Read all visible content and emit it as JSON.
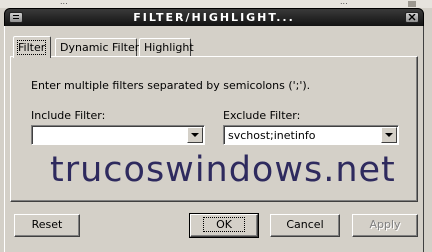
{
  "window": {
    "title": "FILTER/HIGHLIGHT..."
  },
  "background": {
    "text_left": "...",
    "text_right": "..."
  },
  "tabs": [
    {
      "label": "Filter",
      "active": true
    },
    {
      "label": "Dynamic Filters",
      "active": false
    },
    {
      "label": "Highlight",
      "active": false
    }
  ],
  "filter": {
    "instructions": "Enter multiple filters separated by semicolons (';').",
    "include_label": "Include Filter:",
    "include_value": "",
    "exclude_label": "Exclude Filter:",
    "exclude_value": "svchost;inetinfo"
  },
  "watermark": "trucoswindows.net",
  "buttons": {
    "reset": "Reset",
    "ok": "OK",
    "cancel": "Cancel",
    "apply": "Apply",
    "apply_enabled": false
  },
  "colors": {
    "face": "#d4d0c8",
    "titlebar": "#121212",
    "watermark": "#2e2a5e"
  }
}
